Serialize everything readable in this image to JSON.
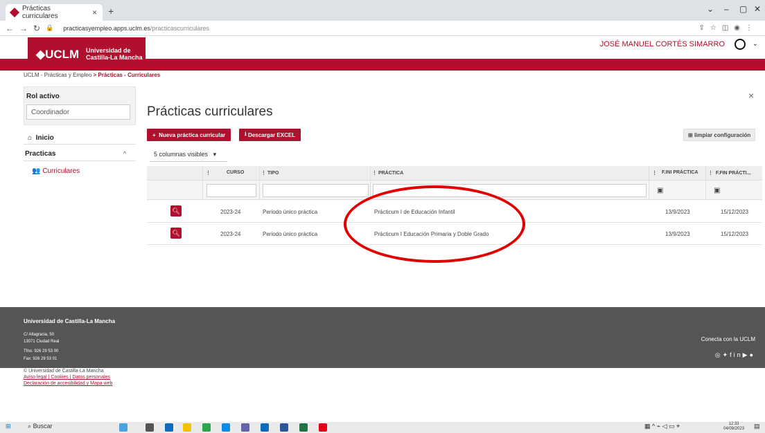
{
  "browser": {
    "tab_title": "Prácticas curriculares",
    "tab_close": "×",
    "new_tab": "+",
    "url_domain": "practicasyempleo.apps.uclm.es",
    "url_path": "/practicascurriculares",
    "win_min": "–",
    "win_max": "▢",
    "win_close": "✕"
  },
  "header": {
    "logo": "UCLM",
    "university_line1": "Universidad de",
    "university_line2": "Castilla-La Mancha",
    "user_name": "JOSÉ MANUEL CORTÉS SIMARRO",
    "breadcrumb_root": "UCLM - Prácticas y Empleo",
    "breadcrumb_current": "> Prácticas - Curriculares"
  },
  "sidebar": {
    "role_label": "Rol activo",
    "role_value": "Coordinador",
    "inicio": "Inicio",
    "practicas": "Practicas",
    "curriculares": "Curriculares"
  },
  "main": {
    "title": "Prácticas curriculares",
    "btn_new": "Nueva práctica curricular",
    "btn_excel": "Descargar EXCEL",
    "btn_clear": "limpiar configuración",
    "columns_visible": "5 columnas visibles",
    "columns": {
      "curso": "CURSO",
      "tipo": "TIPO",
      "practica": "PRÁCTICA",
      "fini": "F.INI PRÁCTICA",
      "ffin": "F.FIN PRÁCTI..."
    },
    "rows": [
      {
        "curso": "2023-24",
        "tipo": "Periodo único práctica",
        "practica": "Prácticum I de Educación Infantil",
        "fini": "13/9/2023",
        "ffin": "15/12/2023"
      },
      {
        "curso": "2023-24",
        "tipo": "Periodo único práctica",
        "practica": "Prácticum I Educación Primaria y Doble Grado",
        "fini": "13/9/2023",
        "ffin": "15/12/2023"
      }
    ]
  },
  "footer": {
    "title": "Universidad de Castilla-La Mancha",
    "addr1": "C/ Altagracia, 50",
    "addr2": "13071 Ciudad Real",
    "phone": "Tfno. 926 29 53 00",
    "fax": "Fax: 926 29 53 01",
    "connect": "Conecta con la UCLM",
    "copyright": "© Universidad de Castilla-La Mancha",
    "links1": "Aviso legal | Cookies | Datos personales",
    "links2": "Declaración de accesibilidad y Mapa web"
  },
  "taskbar": {
    "search": "Buscar",
    "time": "12:33",
    "date": "04/09/2023"
  }
}
